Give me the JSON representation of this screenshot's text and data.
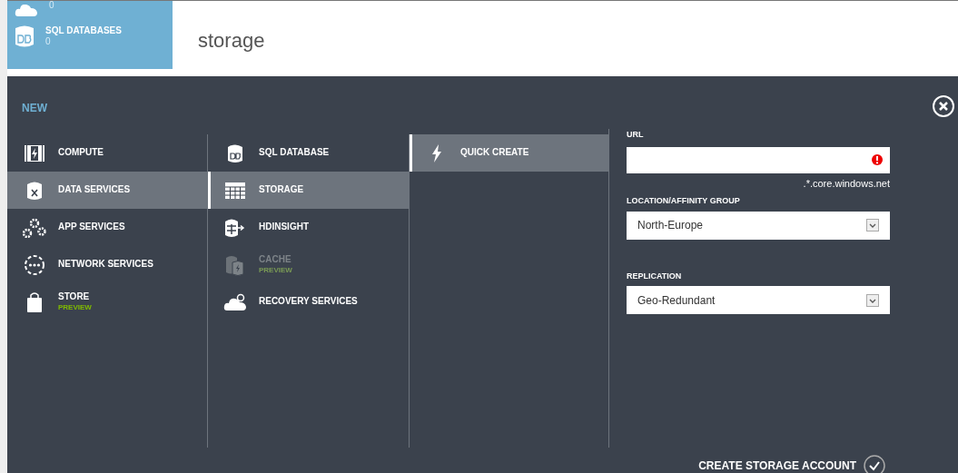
{
  "tile": {
    "entries": [
      {
        "count": "0"
      },
      {
        "label": "SQL DATABASES",
        "count": "0"
      }
    ]
  },
  "page_title": "storage",
  "panel": {
    "title": "NEW",
    "categories": [
      {
        "label": "COMPUTE",
        "selected": false
      },
      {
        "label": "DATA SERVICES",
        "selected": true
      },
      {
        "label": "APP SERVICES",
        "selected": false
      },
      {
        "label": "NETWORK SERVICES",
        "selected": false
      },
      {
        "label": "STORE",
        "badge": "PREVIEW",
        "selected": false
      }
    ],
    "services": [
      {
        "label": "SQL DATABASE",
        "selected": false,
        "disabled": false
      },
      {
        "label": "STORAGE",
        "selected": true,
        "disabled": false
      },
      {
        "label": "HDINSIGHT",
        "selected": false,
        "disabled": false
      },
      {
        "label": "CACHE",
        "badge": "PREVIEW",
        "selected": false,
        "disabled": true
      },
      {
        "label": "RECOVERY SERVICES",
        "selected": false,
        "disabled": false
      }
    ],
    "actions": [
      {
        "label": "QUICK CREATE",
        "selected": true
      }
    ],
    "form": {
      "url": {
        "label": "URL",
        "error": true,
        "suffix": ".*.core.windows.net"
      },
      "location": {
        "label": "LOCATION/AFFINITY GROUP",
        "value": "North-Europe"
      },
      "replication": {
        "label": "REPLICATION",
        "value": "Geo-Redundant"
      }
    },
    "submit": "CREATE STORAGE ACCOUNT"
  }
}
